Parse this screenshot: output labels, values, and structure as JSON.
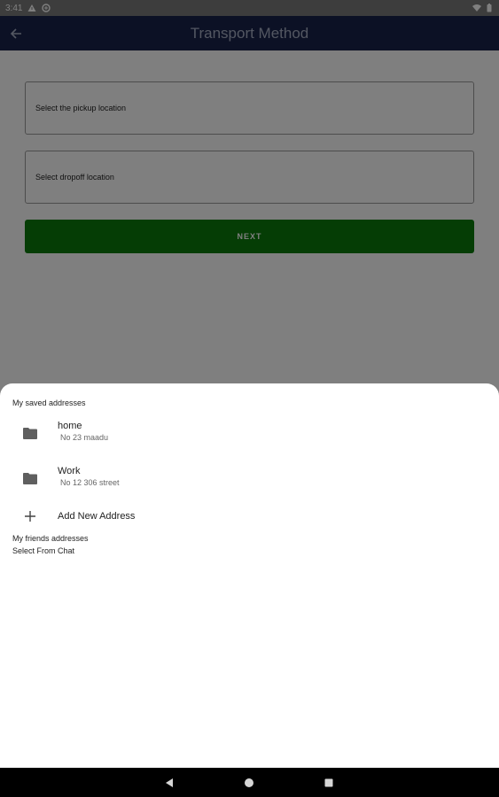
{
  "status_bar": {
    "time": "3:41",
    "icons_left": [
      "alert-icon",
      "data-saver-icon"
    ],
    "icons_right": [
      "wifi-icon",
      "battery-icon"
    ]
  },
  "app_bar": {
    "title": "Transport Method",
    "back_icon": "arrow-left-icon",
    "background": "#18234a"
  },
  "form": {
    "pickup_placeholder": "Select the pickup location",
    "dropoff_placeholder": "Select dropoff location",
    "next_label": "NEXT",
    "next_color": "#0b7a0b"
  },
  "sheet": {
    "saved_title": "My saved addresses",
    "addresses": [
      {
        "name": "home",
        "detail": "No 23 maadu",
        "icon": "folder-icon"
      },
      {
        "name": "Work",
        "detail": "No 12 306 street",
        "icon": "folder-icon"
      }
    ],
    "add_label": "Add New Address",
    "friends_title": "My friends addresses",
    "chat_label": "Select From Chat"
  },
  "nav_bar": {
    "buttons": [
      "back-triangle-icon",
      "home-circle-icon",
      "recents-square-icon"
    ]
  }
}
